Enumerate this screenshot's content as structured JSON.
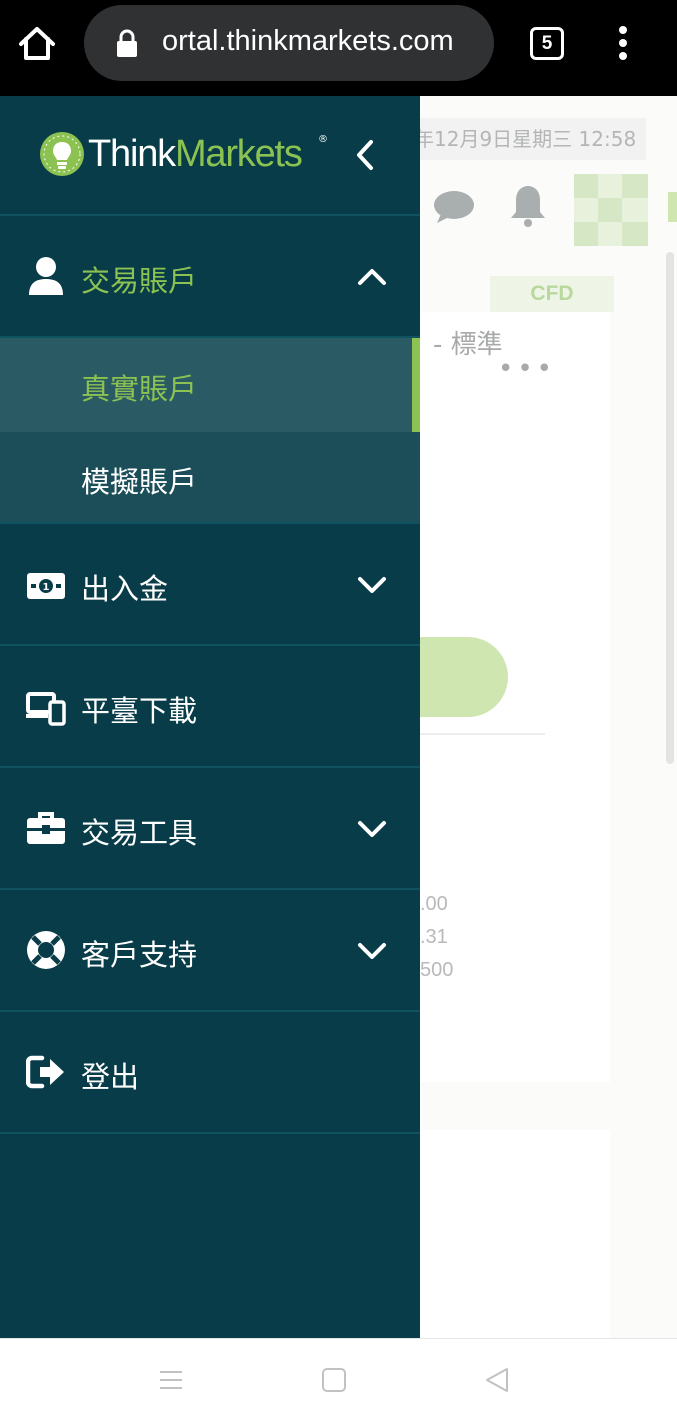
{
  "browser": {
    "url": "ortal.thinkmarkets.com",
    "tab_count": "5"
  },
  "background_page": {
    "datetime": "年12月9日星期三 12:58",
    "cfd_tab": "CFD",
    "account_type": "- 標準",
    "more": "•••",
    "values": [
      ".00",
      ".31",
      "500"
    ]
  },
  "drawer": {
    "logo": {
      "think": "Think",
      "markets": "Markets",
      "reg": "®"
    },
    "menu": [
      {
        "label": "交易賬戶",
        "icon": "user-icon",
        "expanded": true,
        "children": [
          {
            "label": "真實賬戶",
            "active": true
          },
          {
            "label": "模擬賬戶",
            "active": false
          }
        ]
      },
      {
        "label": "出入金",
        "icon": "money-icon",
        "expanded": false
      },
      {
        "label": "平臺下載",
        "icon": "devices-icon"
      },
      {
        "label": "交易工具",
        "icon": "toolbox-icon",
        "expanded": false
      },
      {
        "label": "客戶支持",
        "icon": "lifebuoy-icon",
        "expanded": false
      },
      {
        "label": "登出",
        "icon": "sign-out-icon"
      }
    ]
  },
  "colors": {
    "drawer_bg": "#073c48",
    "accent_green": "#8cc251",
    "submenu_bg": "#1b4e58",
    "submenu_active_bg": "#2a5b65"
  }
}
